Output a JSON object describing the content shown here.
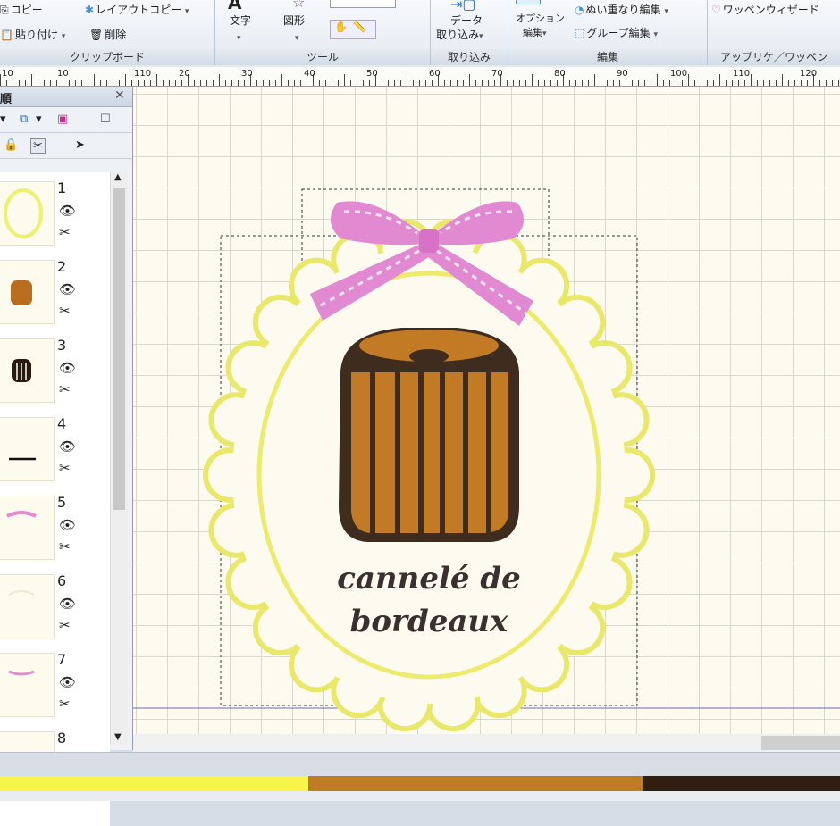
{
  "ribbon": {
    "clipboard": {
      "copy": "コピー",
      "paste": "貼り付け",
      "delete": "削除",
      "layout_copy": "レイアウトコピー",
      "title": "クリップボード"
    },
    "tools": {
      "text": "文字",
      "shape": "図形",
      "title": "ツール"
    },
    "import": {
      "data_import_1": "データ",
      "data_import_2": "取り込み",
      "title": "取り込み"
    },
    "edit": {
      "option_1": "オプション",
      "option_2": "編集",
      "overlap": "ぬい重なり編集",
      "group": "グループ編集",
      "title": "編集"
    },
    "applique": {
      "wizard": "ワッペンウィザード",
      "title": "アップリケ／ワッペン"
    }
  },
  "ruler": {
    "labels": [
      "10",
      "10",
      "110",
      "20",
      "30",
      "40",
      "50",
      "60",
      "70",
      "80",
      "90",
      "100",
      "110",
      "120"
    ]
  },
  "panel": {
    "title": "順",
    "items": [
      {
        "num": "1"
      },
      {
        "num": "2"
      },
      {
        "num": "3"
      },
      {
        "num": "4"
      },
      {
        "num": "5"
      },
      {
        "num": "6"
      },
      {
        "num": "7"
      },
      {
        "num": "8"
      }
    ]
  },
  "design": {
    "line1": "cannelé de",
    "line2": "bordeaux"
  },
  "colors": {
    "yellow": "#f7f05a",
    "brown": "#c07a28",
    "dark": "#3a2818",
    "pink": "#e08ad2",
    "frame": "#e9e86a"
  },
  "colorbar": [
    {
      "color": "#f8f44a",
      "weight": 345
    },
    {
      "color": "#c07b25",
      "weight": 374
    },
    {
      "color": "#321e10",
      "weight": 221
    }
  ]
}
